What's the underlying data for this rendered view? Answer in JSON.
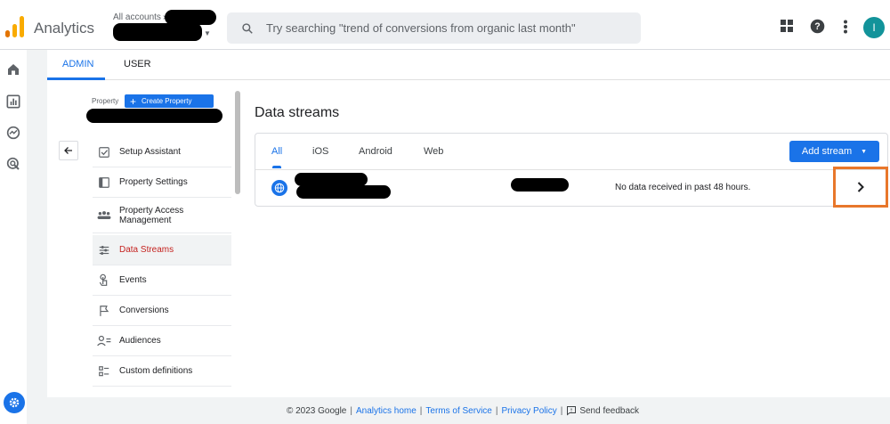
{
  "header": {
    "app_name": "Analytics",
    "account_crumb": "All accounts",
    "search_placeholder": "Try searching \"trend of conversions from organic last month\"",
    "avatar_letter": "I"
  },
  "admin_tabs": [
    {
      "label": "ADMIN",
      "active": true
    },
    {
      "label": "USER",
      "active": false
    }
  ],
  "property": {
    "label": "Property",
    "create_label": "Create Property"
  },
  "property_nav": [
    {
      "label": "Setup Assistant",
      "icon": "checkbox-icon"
    },
    {
      "label": "Property Settings",
      "icon": "settings-page-icon"
    },
    {
      "label": "Property Access Management",
      "icon": "people-icon"
    },
    {
      "label": "Data Streams",
      "icon": "streams-icon",
      "active": true
    },
    {
      "label": "Events",
      "icon": "touch-icon"
    },
    {
      "label": "Conversions",
      "icon": "flag-icon"
    },
    {
      "label": "Audiences",
      "icon": "audience-icon"
    },
    {
      "label": "Custom definitions",
      "icon": "custom-definitions-icon"
    }
  ],
  "data_streams": {
    "title": "Data streams",
    "filter_tabs": [
      {
        "label": "All",
        "active": true
      },
      {
        "label": "iOS"
      },
      {
        "label": "Android"
      },
      {
        "label": "Web"
      }
    ],
    "add_stream_label": "Add stream",
    "rows": [
      {
        "icon": "globe-icon",
        "status": "No data received in past 48 hours."
      }
    ]
  },
  "footer": {
    "copyright": "© 2023 Google",
    "links": [
      "Analytics home",
      "Terms of Service",
      "Privacy Policy"
    ],
    "feedback": "Send feedback"
  },
  "colors": {
    "accent": "#1a73e8",
    "highlight_box": "#e8772b",
    "active_nav_text": "#c5221f"
  }
}
